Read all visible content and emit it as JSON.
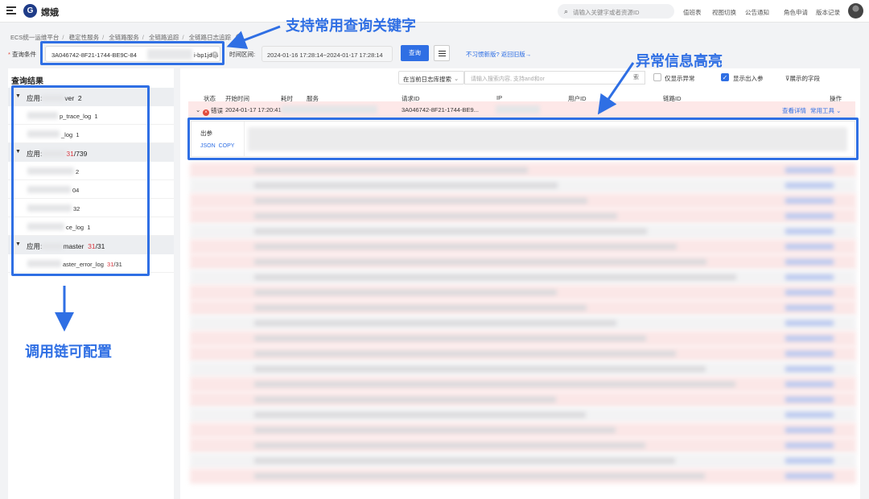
{
  "topbar": {
    "app_name": "嫦娥",
    "logo_icon": "logo-icon",
    "search_placeholder": "请输入关键字或者资源ID",
    "links": [
      "值班表",
      "视图切换",
      "公告通知",
      "角色申请",
      "版本记录"
    ]
  },
  "breadcrumb": [
    "ECS统一运维平台",
    "稳定性服务",
    "全链路服务",
    "全链路追踪",
    "全链路日志追踪"
  ],
  "query": {
    "condition_label": "查询条件",
    "condition_value_start": "3A046742-8F21-1744-BE9C-84",
    "condition_value_end": "i-bp1jdcp",
    "time_label": "时间区间:",
    "time_value": "2024-01-16 17:28:14~2024-01-17 17:28:14",
    "submit_label": "查询",
    "old_version_link": "不习惯新版? 返回旧版→"
  },
  "results": {
    "title": "查询结果",
    "groups": [
      {
        "label": "应用:",
        "name_suffix": "ver",
        "count": "2",
        "items": [
          {
            "label": "p_trace_log",
            "count": "1"
          },
          {
            "label": "_log",
            "count": "1"
          }
        ]
      },
      {
        "label": "应用:",
        "name_suffix": "",
        "count_err": "31",
        "count_total": "/739",
        "items": [
          {
            "label": "",
            "count": "2"
          },
          {
            "label": "",
            "count": "04"
          },
          {
            "label": "",
            "count": "32"
          },
          {
            "label": "ce_log",
            "count": "1"
          }
        ]
      },
      {
        "label": "应用:",
        "name_suffix": "master",
        "count_err": "31",
        "count_total": "/31",
        "items": [
          {
            "label": "aster_error_log",
            "count_err": "31",
            "count_total": "/31"
          }
        ]
      }
    ]
  },
  "table": {
    "scope_select": "在当前日志库搜索",
    "scope_placeholder": "请输入搜索内容, 支持and和or",
    "scope_button": "索",
    "only_error_label": "仅显示异常",
    "show_io_label": "显示出入参",
    "fields_label": "展示的字段",
    "headers": [
      "状态",
      "开始时间",
      "耗时",
      "服务",
      "请求ID",
      "IP",
      "用户ID",
      "链路ID",
      "操作"
    ],
    "row": {
      "status": "错误",
      "start_time": "2024-01-17 17:20:41",
      "request_id": "3A046742-8F21-1744-BE9...",
      "action_detail": "查看详情",
      "action_tools": "常用工具"
    },
    "detail": {
      "name": "出参",
      "json_label": "JSON",
      "copy_label": "COPY"
    }
  },
  "annotations": {
    "keyword": "支持常用查询关键字",
    "highlight": "异常信息高亮",
    "chain": "调用链可配置"
  },
  "colors": {
    "accent": "#2f6fe4",
    "error_row": "#fde8e8",
    "error_text": "#d9363e"
  }
}
